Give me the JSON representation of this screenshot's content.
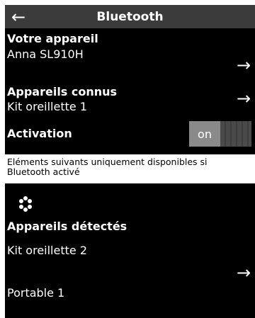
{
  "header": {
    "title": "Bluetooth"
  },
  "your_device": {
    "heading": "Votre appareil",
    "name": "Anna SL910H"
  },
  "known_devices": {
    "heading": "Appareils connus",
    "items": [
      "Kit oreillette 1"
    ]
  },
  "activation": {
    "label": "Activation",
    "toggle_label": "on"
  },
  "info_text": "Eléments suivants uniquement disponibles si Bluetooth activé",
  "detected_devices": {
    "heading": "Appareils détectés",
    "items": [
      "Kit oreillette 2",
      "Portable 1"
    ]
  },
  "icons": {
    "back": "arrow-left-icon",
    "forward": "arrow-right-icon",
    "searching": "spinner-icon"
  },
  "colors": {
    "background": "#000000",
    "header": "#3b3b3b",
    "toggle_on": "#8a8a8a"
  }
}
